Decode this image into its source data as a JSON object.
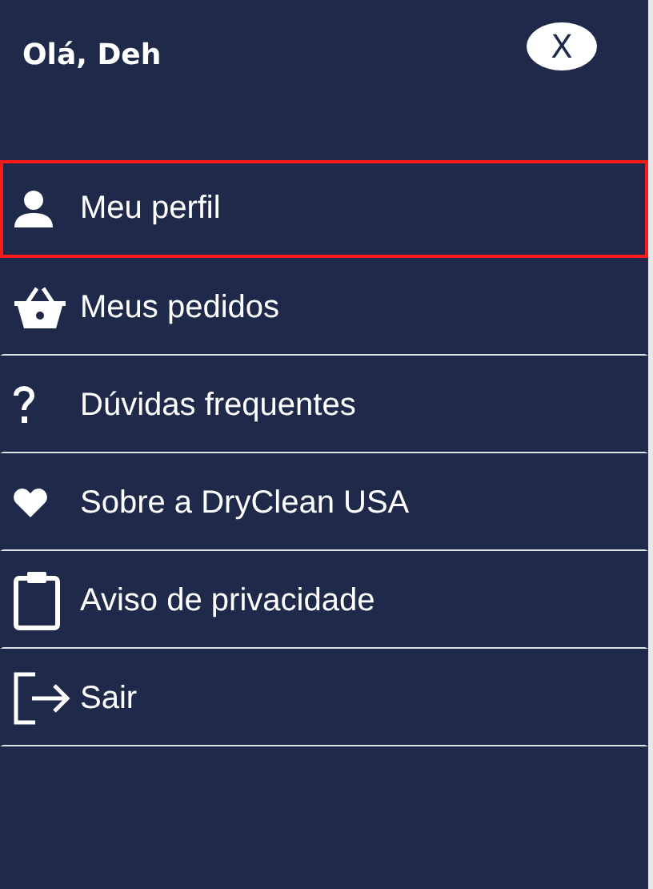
{
  "header": {
    "greeting": "Olá, Deh",
    "close": "X"
  },
  "menu": [
    {
      "label": "Meu perfil",
      "selected": true
    },
    {
      "label": "Meus pedidos",
      "selected": false
    },
    {
      "label": "Dúvidas frequentes",
      "selected": false
    },
    {
      "label": "Sobre a DryClean USA",
      "selected": false
    },
    {
      "label": "Aviso de privacidade",
      "selected": false
    },
    {
      "label": "Sair",
      "selected": false
    }
  ]
}
